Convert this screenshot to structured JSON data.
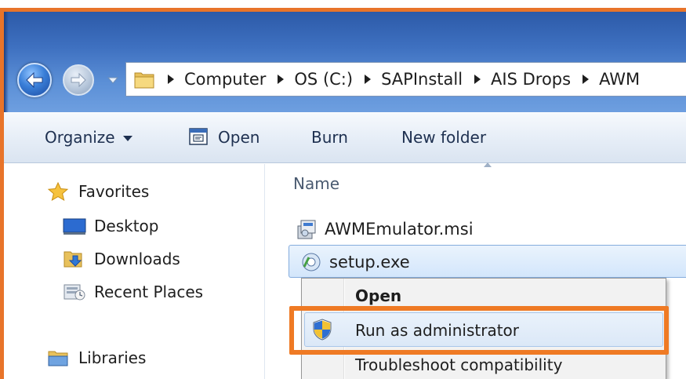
{
  "address_bar": {
    "crumbs": [
      "Computer",
      "OS (C:)",
      "SAPInstall",
      "AIS Drops",
      "AWM"
    ]
  },
  "toolbar": {
    "organize_label": "Organize",
    "open_label": "Open",
    "burn_label": "Burn",
    "new_folder_label": "New folder"
  },
  "navigation": {
    "favorites_label": "Favorites",
    "items": [
      {
        "label": "Desktop",
        "icon": "desktop-icon"
      },
      {
        "label": "Downloads",
        "icon": "downloads-icon"
      },
      {
        "label": "Recent Places",
        "icon": "recent-places-icon"
      }
    ],
    "libraries_label": "Libraries"
  },
  "file_list": {
    "column_name": "Name",
    "files": [
      {
        "name": "AWMEmulator.msi",
        "icon": "msi-installer-icon"
      },
      {
        "name": "setup.exe",
        "icon": "setup-exe-icon",
        "selected": true
      }
    ]
  },
  "context_menu": {
    "items": [
      {
        "label": "Open",
        "default": true
      },
      {
        "label": "Run as administrator",
        "icon": "uac-shield-icon",
        "highlighted": true
      },
      {
        "label": "Troubleshoot compatibility"
      }
    ]
  },
  "colors": {
    "highlight_frame": "#ef7a24",
    "titlebar": "#3e70c0",
    "selection": "#d3e6fb"
  }
}
